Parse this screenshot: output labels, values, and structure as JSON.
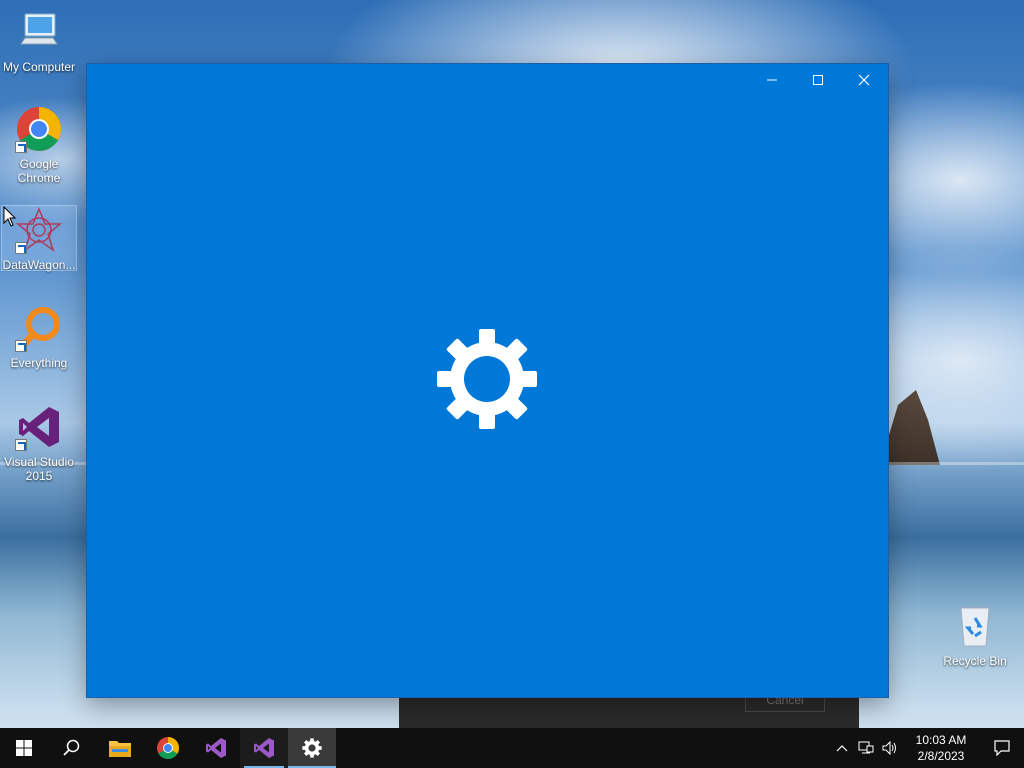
{
  "desktop": {
    "icons": [
      {
        "label": "My Computer",
        "icon": "computer-icon"
      },
      {
        "label": "Google Chrome",
        "icon": "chrome-icon"
      },
      {
        "label": "DataWagon...",
        "icon": "datawagon-icon"
      },
      {
        "label": "Everything",
        "icon": "everything-search-icon"
      },
      {
        "label": "Visual Studio 2015",
        "icon": "visual-studio-icon"
      },
      {
        "label": "Recycle Bin",
        "icon": "recycle-bin-icon"
      }
    ]
  },
  "background_dialog": {
    "button_label": "Cancel"
  },
  "window": {
    "background_color": "#0078d7",
    "controls": [
      "minimize-icon",
      "maximize-icon",
      "close-icon"
    ],
    "center_icon": "gear-icon"
  },
  "taskbar": {
    "buttons": [
      {
        "icon": "windows-start-icon"
      },
      {
        "icon": "search-icon"
      },
      {
        "icon": "file-explorer-icon"
      },
      {
        "icon": "chrome-icon"
      },
      {
        "icon": "visual-studio-icon"
      },
      {
        "icon": "visual-studio-icon",
        "running": true
      },
      {
        "icon": "settings-gear-icon",
        "active": true
      }
    ],
    "tray": {
      "icons": [
        "chevron-up-icon",
        "network-icon",
        "volume-icon"
      ],
      "time": "10:03 AM",
      "date": "2/8/2023",
      "notification_icon": "action-center-icon"
    }
  }
}
